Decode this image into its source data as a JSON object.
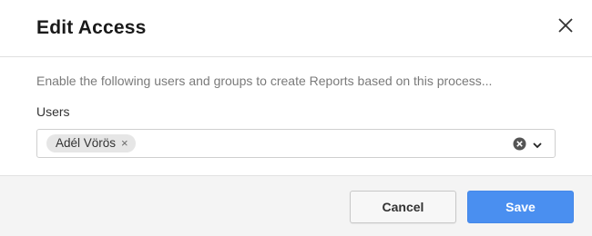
{
  "dialog": {
    "title": "Edit Access",
    "description": "Enable the following users and groups to create Reports based on this process...",
    "users_label": "Users",
    "selected_users": [
      {
        "name": "Adél Vörös",
        "remove_glyph": "×"
      }
    ],
    "cancel_label": "Cancel",
    "save_label": "Save"
  },
  "icons": {
    "close": "close-icon",
    "chip_remove": "remove-chip-icon",
    "clear": "clear-all-icon",
    "dropdown": "chevron-down-icon"
  },
  "colors": {
    "primary": "#4a8ff0",
    "footer_bg": "#f4f4f4"
  }
}
